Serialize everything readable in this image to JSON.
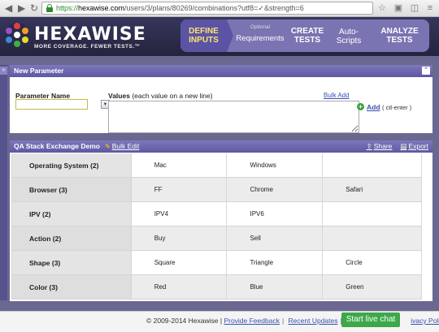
{
  "browser": {
    "url_scheme": "https://",
    "url_host": "hexawise.com",
    "url_path": "/users/3/plans/80269/combinations?utf8=✓&strength=6",
    "icons": [
      "back-arrow-icon",
      "forward-arrow-icon",
      "lock-icon",
      "reload-icon",
      "star-icon",
      "extension-icon",
      "menu-icon"
    ]
  },
  "header": {
    "brand": "HEXAWISE",
    "tagline": "MORE COVERAGE. FEWER TESTS.™",
    "steps": [
      {
        "line1": "DEFINE",
        "line2": "INPUTS",
        "optional": ""
      },
      {
        "line1": "Requirements",
        "line2": "",
        "optional": "Optional"
      },
      {
        "line1": "CREATE",
        "line2": "TESTS",
        "optional": ""
      },
      {
        "line1": "Auto-",
        "line2": "Scripts",
        "optional": ""
      },
      {
        "line1": "ANALYZE",
        "line2": "TESTS",
        "optional": ""
      }
    ],
    "colors": {
      "active_text": "#ffe36e",
      "bar": "#7a74b2"
    }
  },
  "sidebar": {
    "toggle": "»"
  },
  "new_parameter": {
    "title": "New Parameter",
    "collapse": "»",
    "param_name_label": "Parameter Name",
    "param_name_value": "",
    "values_label": "Values",
    "values_note": "(each value on a new line)",
    "values_value": "",
    "bulk_add": "Bulk Add",
    "add_label": "Add",
    "add_hint": "( ctl-enter )"
  },
  "demo": {
    "title": "QA Stack Exchange Demo",
    "bulk_edit": "Bulk Edit",
    "share": "Share",
    "export": "Export",
    "parameters": [
      {
        "name": "Operating System (2)",
        "values": [
          "Mac",
          "Windows",
          ""
        ]
      },
      {
        "name": "Browser (3)",
        "values": [
          "FF",
          "Chrome",
          "Safari"
        ]
      },
      {
        "name": "IPV (2)",
        "values": [
          "IPV4",
          "IPV6",
          ""
        ]
      },
      {
        "name": "Action (2)",
        "values": [
          "Buy",
          "Sell",
          ""
        ]
      },
      {
        "name": "Shape (3)",
        "values": [
          "Square",
          "Triangle",
          "Circle"
        ]
      },
      {
        "name": "Color (3)",
        "values": [
          "Red",
          "Blue",
          "Green"
        ]
      }
    ]
  },
  "footer": {
    "copyright": "© 2009-2014 Hexawise |",
    "links": [
      "Provide Feedback",
      "Recent Updates",
      "Te",
      "ivacy Policy"
    ],
    "live_chat": "Start live chat"
  }
}
